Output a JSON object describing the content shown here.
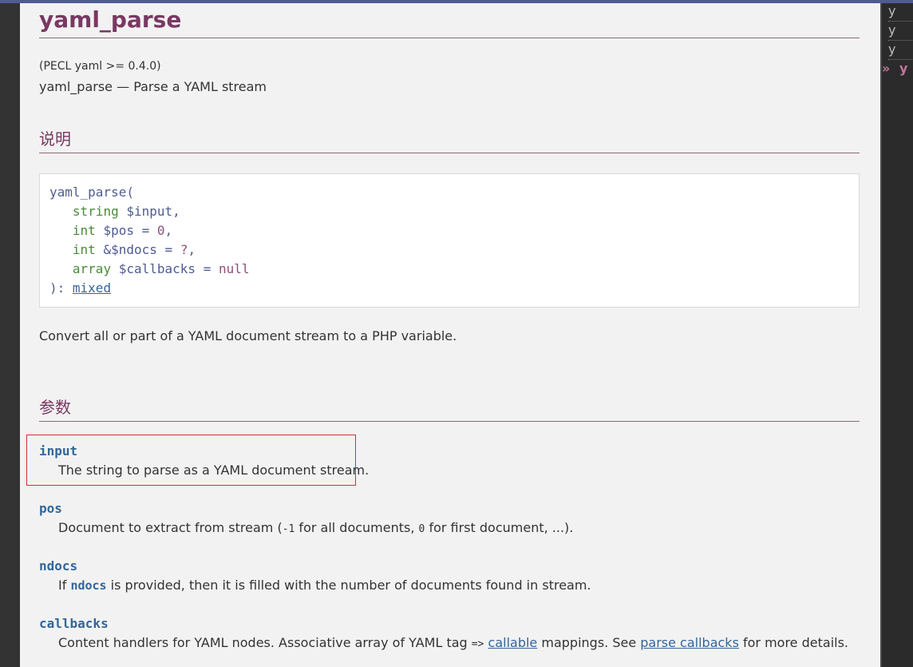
{
  "function_name": "yaml_parse",
  "version": "(PECL yaml >= 0.4.0)",
  "refpurpose": "yaml_parse — Parse a YAML stream",
  "section_description": "说明",
  "synopsis": {
    "name": "yaml_parse(",
    "params": [
      {
        "type": "string",
        "var": "$input",
        "default": "",
        "trail": ","
      },
      {
        "type": "int",
        "var": "$pos",
        "default": "0",
        "trail": ","
      },
      {
        "type": "int",
        "var": "&$ndocs",
        "default": "?",
        "trail": ","
      },
      {
        "type": "array",
        "var": "$callbacks",
        "default": "null",
        "trail": ""
      }
    ],
    "close": "): ",
    "return_type": "mixed"
  },
  "description_text": "Convert all or part of a YAML document stream to a PHP variable.",
  "section_parameters": "参数",
  "parameters": {
    "input": {
      "name": "input",
      "desc": "The string to parse as a YAML document stream."
    },
    "pos": {
      "name": "pos",
      "desc_before": "Document to extract from stream (",
      "code1": "-1",
      "desc_mid": " for all documents, ",
      "code2": "0",
      "desc_after": " for first document, ...)."
    },
    "ndocs": {
      "name": "ndocs",
      "desc_before": "If ",
      "code": "ndocs",
      "desc_after": " is provided, then it is filled with the number of documents found in stream."
    },
    "callbacks": {
      "name": "callbacks",
      "desc_before": "Content handlers for YAML nodes. Associative array of YAML tag ",
      "arrow": "=>",
      "link1": "callable",
      "desc_mid": " mappings. See ",
      "link2": "parse callbacks",
      "desc_after": " for more details."
    }
  },
  "right_nav": {
    "items": [
      "y",
      "y",
      "y"
    ],
    "current_mark": "»",
    "current": "y"
  },
  "colors": {
    "title": "#793862",
    "link": "#336699",
    "background": "#f2f2f2",
    "highlight_border": "#d03030"
  }
}
